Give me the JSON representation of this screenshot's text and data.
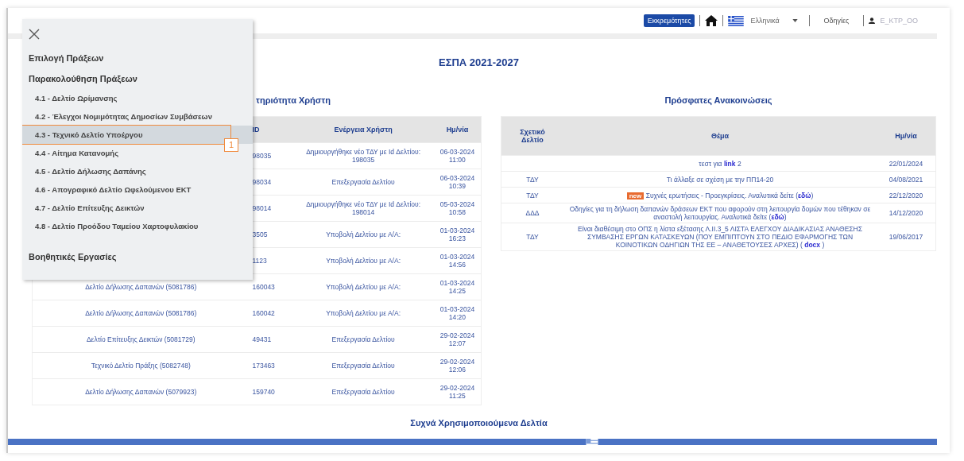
{
  "top_bar": {
    "pending_button": "Εκκρεμότητες",
    "language": "Ελληνικά",
    "help_link": "Οδηγίες",
    "user": "Ε_ΚΤΡ_ΟΟ"
  },
  "page_title": "ΕΣΠΑ 2021-2027",
  "activity": {
    "title": "τηριότητα Χρήστη",
    "columns": [
      "ID",
      "Ενέργεια Χρήστη",
      "Ημ/νία"
    ],
    "rows": [
      {
        "id": "98035",
        "action": "Δημιουργήθηκε νέο ΤΔΥ με Id Δελτίου: 198035",
        "date": "06-03-2024 11:00"
      },
      {
        "id": "98034",
        "action": "Επεξεργασία Δελτίου",
        "date": "06-03-2024 10:39"
      },
      {
        "id": "98014",
        "action": "Δημιουργήθηκε νέο ΤΔΥ με Id Δελτίου: 198014",
        "date": "05-03-2024 10:58"
      },
      {
        "id": "3505",
        "action": "Υποβολή Δελτίου με Α/Α:",
        "date": "01-03-2024 16:23"
      },
      {
        "id": "1123",
        "action": "Υποβολή Δελτίου με Α/Α:",
        "date": "01-03-2024 14:56"
      },
      {
        "report": "Δελτίο Δήλωσης Δαπανών (5081786)",
        "id": "160043",
        "action": "Υποβολή Δελτίου με Α/Α:",
        "date": "01-03-2024 14:25"
      },
      {
        "report": "Δελτίο Δήλωσης Δαπανών (5081786)",
        "id": "160042",
        "action": "Υποβολή Δελτίου με Α/Α:",
        "date": "01-03-2024 14:20"
      },
      {
        "report": "Δελτίο Επίτευξης Δεικτών (5081729)",
        "id": "49431",
        "action": "Επεξεργασία Δελτίου",
        "date": "29-02-2024 12:07"
      },
      {
        "report": "Τεχνικό Δελτίο Πράξης (5082748)",
        "id": "173463",
        "action": "Επεξεργασία Δελτίου",
        "date": "29-02-2024 12:06"
      },
      {
        "report": "Δελτίο Δήλωσης Δαπανών (5079923)",
        "id": "159740",
        "action": "Επεξεργασία Δελτίου",
        "date": "29-02-2024 11:25"
      }
    ]
  },
  "announcements": {
    "title": "Πρόσφατες Ανακοινώσεις",
    "columns": [
      "Σχετικό Δελτίο",
      "Θέμα",
      "Ημ/νία"
    ],
    "rows": [
      {
        "subject": "τεστ για **link** 2",
        "date": "22/01/2024"
      },
      {
        "related": "ΤΔΥ",
        "subject": "Τι άλλαξε σε σχέση με την ΠΠ14-20",
        "date": "04/08/2021"
      },
      {
        "related": "ΤΔΥ",
        "badge": "new",
        "subject": "Συχνές ερωτήσεις - Προεγκρίσεις. Αναλυτικά δείτε (**εδώ**)",
        "date": "22/12/2020"
      },
      {
        "related": "ΔΔΔ",
        "subject": "Οδηγίες για τη δήλωση δαπανών δράσεων ΕΚΤ που αφορούν στη λειτουργία δομών που τέθηκαν σε αναστολή λειτουργίας. Αναλυτικά δείτε (**εδώ**)",
        "date": "14/12/2020"
      },
      {
        "related": "ΤΔΥ",
        "subject": "Είναι διαθέσιμη στο ΟΠΣ η λίστα εξέτασης Λ.ΙΙ.3_5 ΛΙΣΤΑ ΕΛΕΓΧΟΥ ΔΙΑΔΙΚΑΣΙΑΣ ΑΝΑΘΕΣΗΣ ΣΥΜΒΑΣΗΣ ΕΡΓΩΝ ΚΑΤΑΣΚΕΥΩΝ (ΠΟΥ ΕΜΠΙΠΤΟΥΝ ΣΤΟ ΠΕΔΙΟ ΕΦΑΡΜΟΓΗΣ ΤΩΝ ΚΟΙΝΟΤΙΚΩΝ ΟΔΗΓΙΩΝ ΤΗΣ ΕΕ – ΑΝΑΘΕΤΟΥΣΕΣ ΑΡΧΕΣ) ( **docx** )",
        "date": "19/06/2017"
      }
    ]
  },
  "frequent_title": "Συχνά Χρησιμοποιούμενα Δελτία",
  "menu": {
    "items": [
      {
        "kind": "section",
        "label": "Επιλογή Πράξεων",
        "selected": false
      },
      {
        "kind": "section",
        "label": "Παρακολούθηση Πράξεων",
        "selected": false
      },
      {
        "kind": "item",
        "label": "4.1 - Δελτίο Ωρίμανσης",
        "selected": false
      },
      {
        "kind": "item",
        "label": "4.2 - Έλεγχοι Νομιμότητας Δημοσίων Συμβάσεων",
        "selected": false
      },
      {
        "kind": "item",
        "label": "4.3 - Τεχνικό Δελτίο Υποέργου",
        "selected": true,
        "callout": "1"
      },
      {
        "kind": "item",
        "label": "4.4 - Αίτημα Κατανομής",
        "selected": false
      },
      {
        "kind": "item",
        "label": "4.5 - Δελτίο Δήλωσης Δαπάνης",
        "selected": false
      },
      {
        "kind": "item",
        "label": "4.6 - Απογραφικό Δελτίο Ωφελούμενου ΕΚΤ",
        "selected": false
      },
      {
        "kind": "item",
        "label": "4.7 - Δελτίο Επίτευξης Δεικτών",
        "selected": false
      },
      {
        "kind": "item",
        "label": "4.8 - Δελτίο Προόδου Ταμείου Χαρτοφυλακίου",
        "selected": false
      },
      {
        "kind": "section",
        "label": "Βοηθητικές Εργασίες",
        "selected": false
      }
    ]
  }
}
